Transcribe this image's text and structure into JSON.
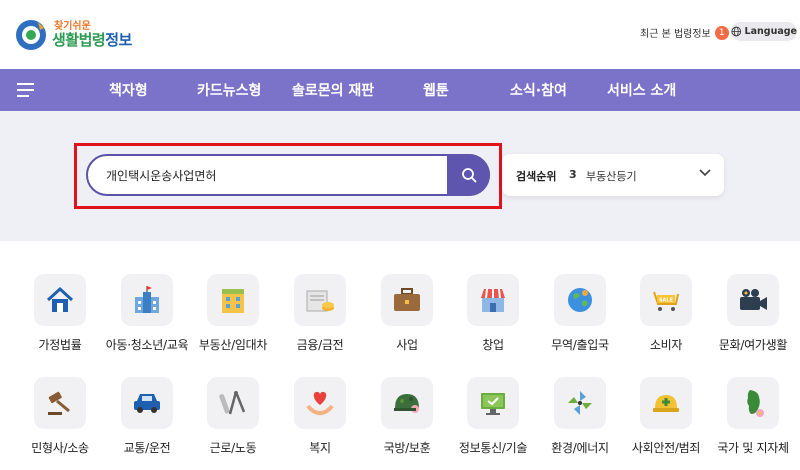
{
  "header": {
    "logo_sub": "찾기쉬운",
    "logo_main_a": "생활법령",
    "logo_main_b": "정보",
    "recent_label": "최근 본 법령정보",
    "recent_count": "1",
    "language_label": "Language"
  },
  "nav": {
    "items": [
      "책자형",
      "카드뉴스형",
      "솔로몬의 재판",
      "웹툰",
      "소식·참여",
      "서비스 소개"
    ]
  },
  "search": {
    "value": "개인택시운송사업면허"
  },
  "rank": {
    "label": "검색순위",
    "number": "3",
    "term": "부동산등기"
  },
  "categories": [
    {
      "label": "가정법률",
      "icon": "house-icon"
    },
    {
      "label": "아동·청소년/교육",
      "icon": "school-icon"
    },
    {
      "label": "부동산/임대차",
      "icon": "building-icon"
    },
    {
      "label": "금융/금전",
      "icon": "money-icon"
    },
    {
      "label": "사업",
      "icon": "briefcase-icon"
    },
    {
      "label": "창업",
      "icon": "storefront-icon"
    },
    {
      "label": "무역/출입국",
      "icon": "globe-icon"
    },
    {
      "label": "소비자",
      "icon": "sale-cart-icon"
    },
    {
      "label": "문화/여가생활",
      "icon": "camera-icon"
    },
    {
      "label": "민형사/소송",
      "icon": "gavel-icon"
    },
    {
      "label": "교통/운전",
      "icon": "car-icon"
    },
    {
      "label": "근로/노동",
      "icon": "tools-icon"
    },
    {
      "label": "복지",
      "icon": "heart-hands-icon"
    },
    {
      "label": "국방/보훈",
      "icon": "helmet-icon"
    },
    {
      "label": "정보통신/기술",
      "icon": "monitor-icon"
    },
    {
      "label": "환경/에너지",
      "icon": "pinwheel-icon"
    },
    {
      "label": "사회안전/범죄",
      "icon": "hardhat-icon"
    },
    {
      "label": "국가 및 지자체",
      "icon": "korea-map-icon"
    }
  ],
  "colors": {
    "nav_bg": "#7b72c9",
    "search_btn": "#5e56ae",
    "highlight": "#e0121c"
  }
}
